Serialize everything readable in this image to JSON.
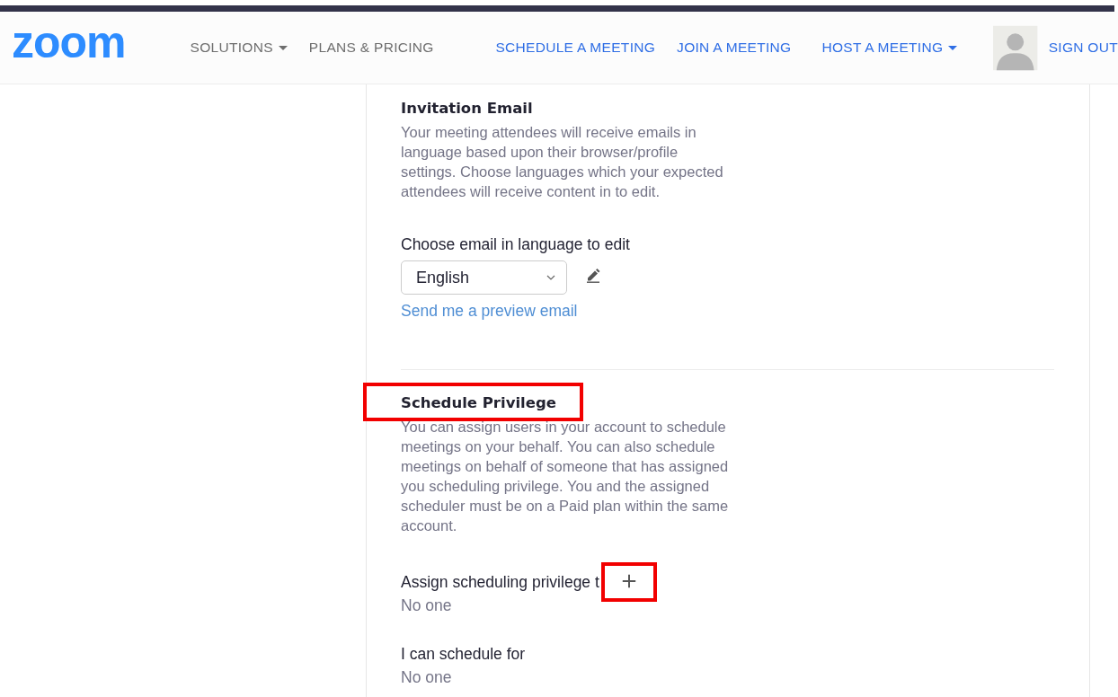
{
  "header": {
    "logo": "zoom",
    "nav_left": [
      {
        "label": "SOLUTIONS",
        "dropdown": true
      },
      {
        "label": "PLANS & PRICING",
        "dropdown": false
      }
    ],
    "nav_right": [
      {
        "label": "SCHEDULE A MEETING",
        "dropdown": false
      },
      {
        "label": "JOIN A MEETING",
        "dropdown": false
      },
      {
        "label": "HOST A MEETING",
        "dropdown": true
      }
    ],
    "sign_out": "SIGN OUT"
  },
  "invitation": {
    "title": "Invitation Email",
    "description": "Your meeting attendees will receive emails in language based upon their browser/profile settings. Choose languages which your expected attendees will receive content in to edit.",
    "language_label": "Choose email in language to edit",
    "language_value": "English",
    "preview_link": "Send me a preview email"
  },
  "schedule_privilege": {
    "title": "Schedule Privilege",
    "title_highlighted": true,
    "description": "You can assign users in your account to schedule meetings on your behalf. You can also schedule meetings on behalf of someone that has assigned you scheduling privilege. You and the assigned scheduler must be on a Paid plan within the same account.",
    "assign_label": "Assign scheduling privilege t",
    "add_highlighted": true,
    "assign_value": "No one",
    "schedule_for_label": "I can schedule for",
    "schedule_for_value": "No one"
  }
}
